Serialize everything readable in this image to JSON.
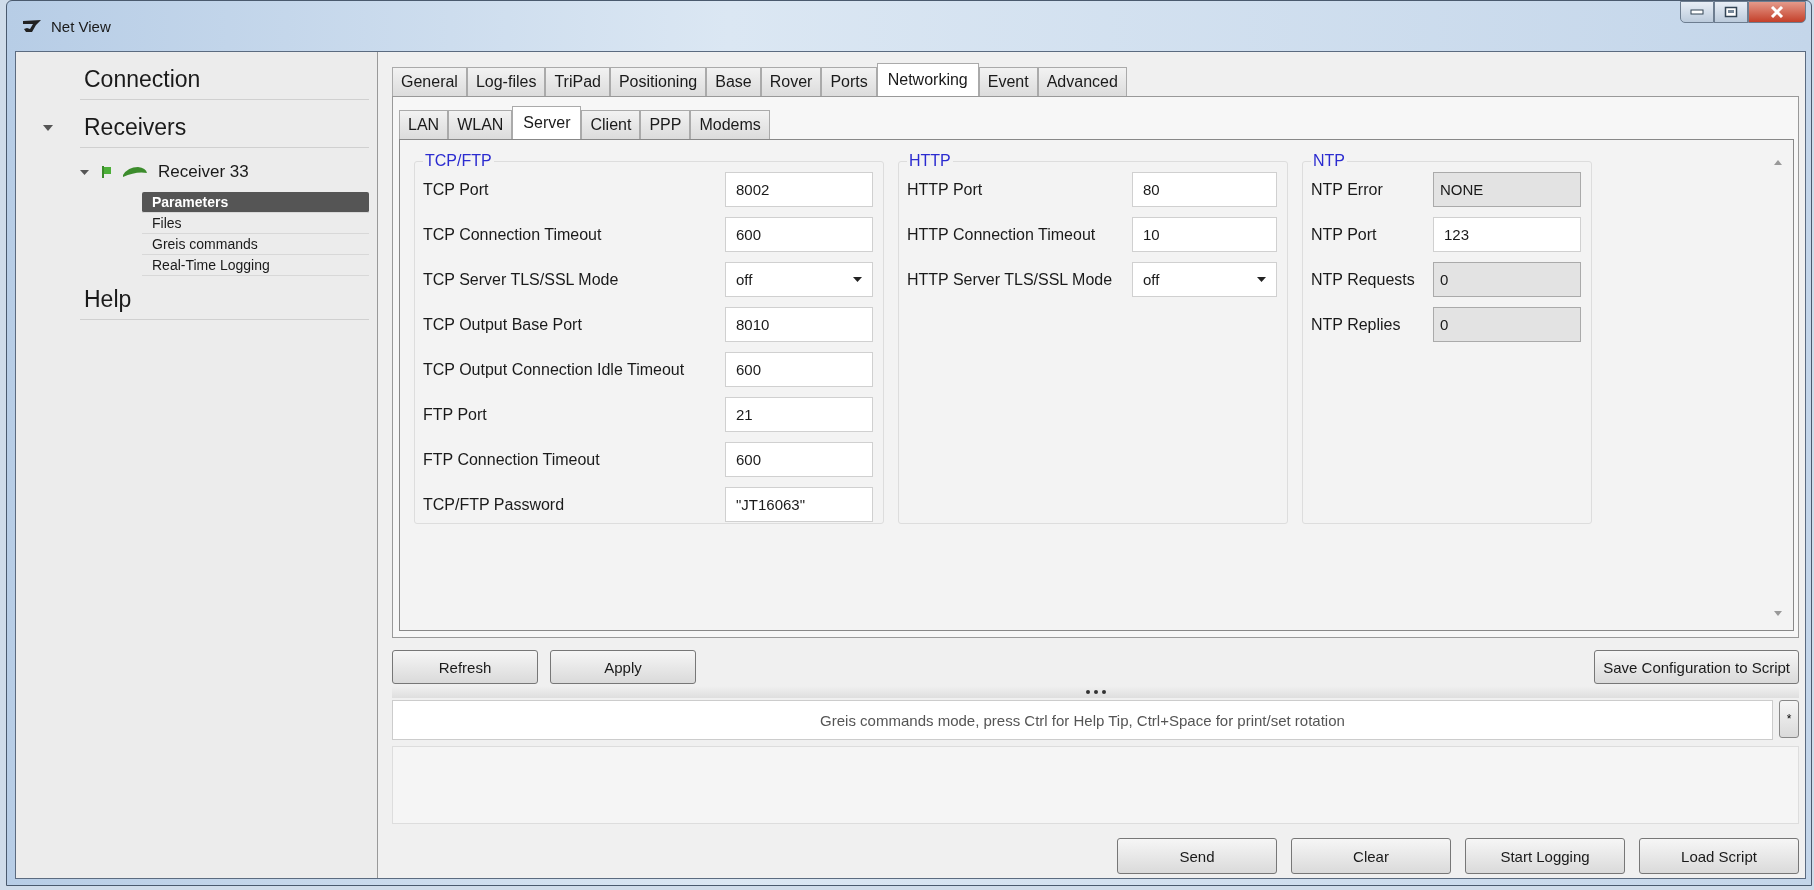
{
  "window": {
    "title": "Net View"
  },
  "sidebar": [
    {
      "label": "Connection"
    },
    {
      "label": "Receivers",
      "expanded": true,
      "children": [
        {
          "label": "Receiver 33",
          "expanded": true,
          "children": [
            {
              "label": "Parameters",
              "selected": true
            },
            {
              "label": "Files",
              "selected": false
            },
            {
              "label": "Greis commands",
              "selected": false
            },
            {
              "label": "Real-Time Logging",
              "selected": false
            }
          ]
        }
      ]
    },
    {
      "label": "Help"
    }
  ],
  "tabs": [
    {
      "label": "General",
      "selected": false
    },
    {
      "label": "Log-files",
      "selected": false
    },
    {
      "label": "TriPad",
      "selected": false
    },
    {
      "label": "Positioning",
      "selected": false
    },
    {
      "label": "Base",
      "selected": false
    },
    {
      "label": "Rover",
      "selected": false
    },
    {
      "label": "Ports",
      "selected": false
    },
    {
      "label": "Networking",
      "selected": true
    },
    {
      "label": "Event",
      "selected": false
    },
    {
      "label": "Advanced",
      "selected": false
    }
  ],
  "subtabs": [
    {
      "label": "LAN",
      "selected": false
    },
    {
      "label": "WLAN",
      "selected": false
    },
    {
      "label": "Server",
      "selected": true
    },
    {
      "label": "Client",
      "selected": false
    },
    {
      "label": "PPP",
      "selected": false
    },
    {
      "label": "Modems",
      "selected": false
    }
  ],
  "groups": [
    {
      "title": "TCP/FTP",
      "fields": [
        {
          "label": "TCP Port",
          "kind": "text",
          "value": "8002"
        },
        {
          "label": "TCP Connection Timeout",
          "kind": "text",
          "value": "600"
        },
        {
          "label": "TCP Server TLS/SSL Mode",
          "kind": "dropdown",
          "value": "off"
        },
        {
          "label": "TCP Output Base Port",
          "kind": "text",
          "value": "8010"
        },
        {
          "label": "TCP Output Connection Idle Timeout",
          "kind": "text",
          "value": "600"
        },
        {
          "label": "FTP Port",
          "kind": "text",
          "value": "21"
        },
        {
          "label": "FTP Connection Timeout",
          "kind": "text",
          "value": "600"
        },
        {
          "label": "TCP/FTP Password",
          "kind": "text",
          "value": "\"JT16063\""
        }
      ]
    },
    {
      "title": "HTTP",
      "fields": [
        {
          "label": "HTTP Port",
          "kind": "text",
          "value": "80"
        },
        {
          "label": "HTTP Connection Timeout",
          "kind": "text",
          "value": "10"
        },
        {
          "label": "HTTP Server TLS/SSL Mode",
          "kind": "dropdown",
          "value": "off"
        }
      ]
    },
    {
      "title": "NTP",
      "fields": [
        {
          "label": "NTP Error",
          "kind": "readonly",
          "value": "NONE"
        },
        {
          "label": "NTP Port",
          "kind": "text",
          "value": "123"
        },
        {
          "label": "NTP Requests",
          "kind": "readonly",
          "value": "0"
        },
        {
          "label": "NTP Replies",
          "kind": "readonly",
          "value": "0"
        }
      ]
    }
  ],
  "actions": {
    "left": [
      "Refresh",
      "Apply"
    ],
    "right": "Save Configuration to Script"
  },
  "command": {
    "placeholder": "Greis commands mode, press Ctrl for Help Tip, Ctrl+Space for print/set rotation",
    "side_button": "*"
  },
  "bottom_buttons": [
    "Send",
    "Clear",
    "Start Logging",
    "Load Script"
  ]
}
